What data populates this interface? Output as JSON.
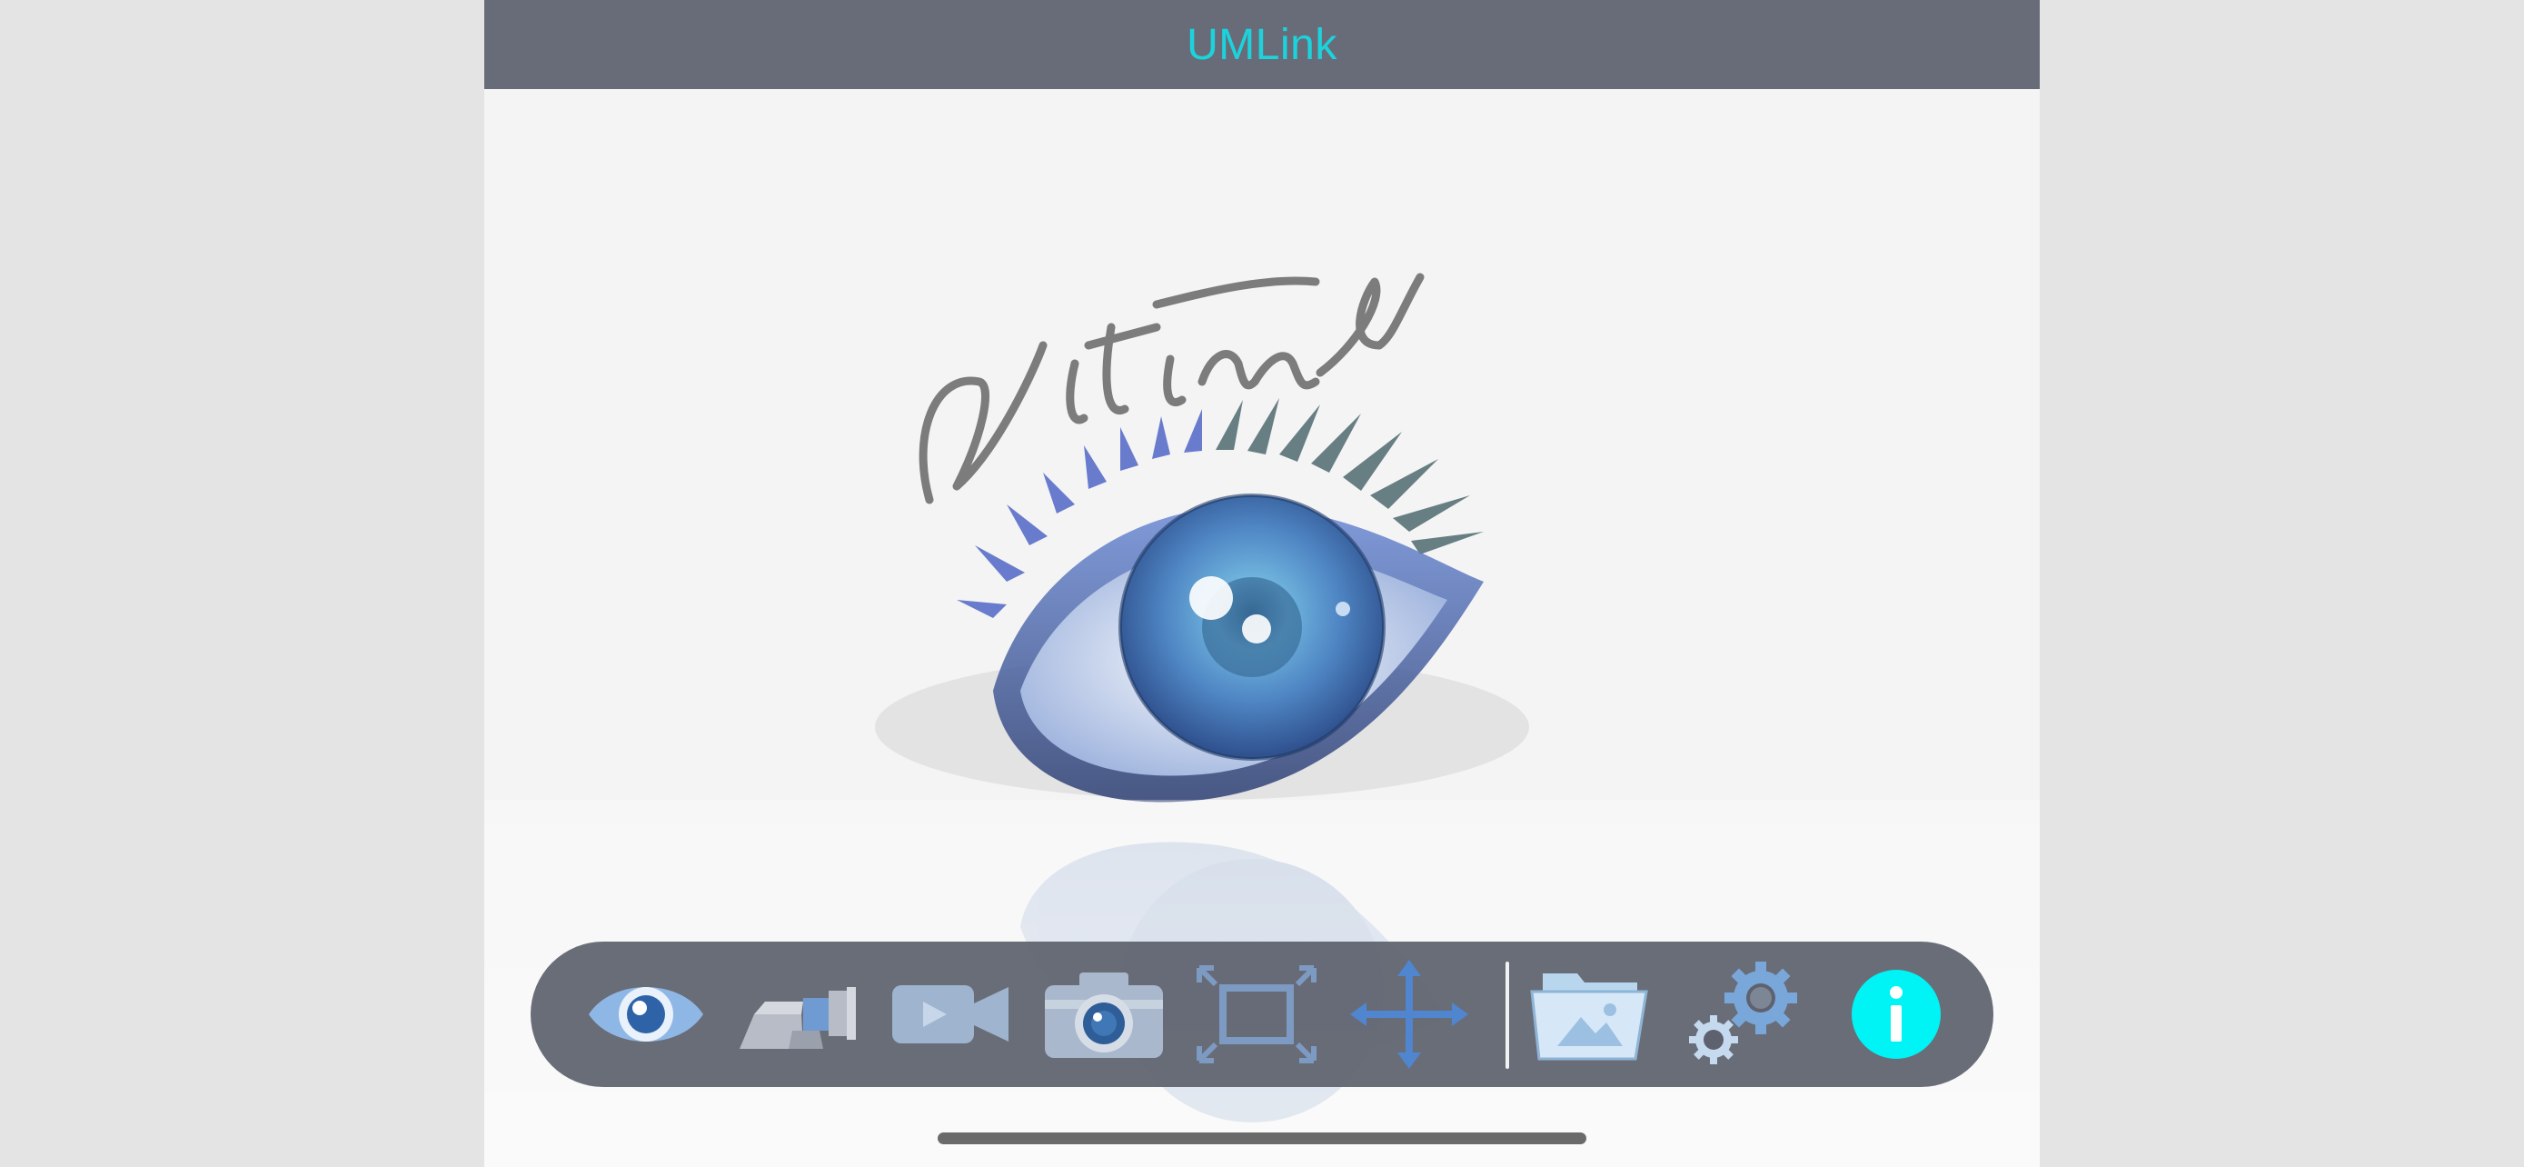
{
  "app": {
    "title": "UMLink"
  },
  "logo": {
    "signature": "Vitiny",
    "name": "vitiny-eye-logo"
  },
  "toolbar": {
    "items": [
      {
        "name": "live-view",
        "icon": "eye-icon"
      },
      {
        "name": "microscope",
        "icon": "microscope-icon"
      },
      {
        "name": "record-video",
        "icon": "video-camera-icon"
      },
      {
        "name": "capture-photo",
        "icon": "camera-icon"
      },
      {
        "name": "fullscreen",
        "icon": "fullscreen-icon"
      },
      {
        "name": "move",
        "icon": "move-arrows-icon"
      },
      {
        "name": "gallery",
        "icon": "photo-folder-icon"
      },
      {
        "name": "settings",
        "icon": "gear-icon"
      },
      {
        "name": "info",
        "icon": "info-icon"
      }
    ]
  },
  "colors": {
    "title": "#1cd3dd",
    "titlebar": "#686c78",
    "toolbar": "#5e626e",
    "icon_blue": "#7eaee0",
    "info": "#00f3f5"
  }
}
